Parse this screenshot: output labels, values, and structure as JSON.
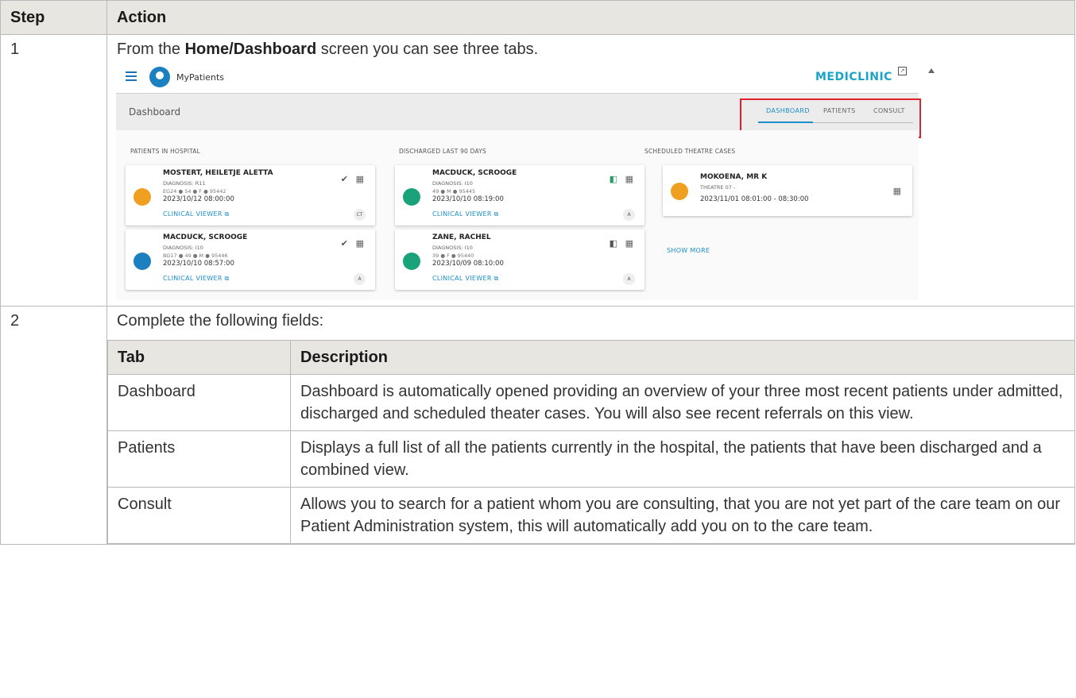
{
  "header": {
    "step_label": "Step",
    "action_label": "Action"
  },
  "row1": {
    "step": "1",
    "text_before": "From the ",
    "text_bold": "Home/Dashboard",
    "text_after": " screen you can see three tabs.",
    "screenshot": {
      "app_name": "MyPatients",
      "brand": "MEDICLINIC",
      "page_title": "Dashboard",
      "tabs": [
        "DASHBOARD",
        "PATIENTS",
        "CONSULT"
      ],
      "active_tab": "DASHBOARD",
      "sections": {
        "in_hospital": "PATIENTS IN HOSPITAL",
        "discharged": "DISCHARGED LAST 90 DAYS",
        "theatre": "SCHEDULED THEATRE CASES"
      },
      "cards": [
        {
          "name": "MOSTERT, HEILETJE ALETTA",
          "diagnosis": "DIAGNOSIS: R11",
          "info": "EG24 ● 54 ● F ● 95442",
          "datetime": "2023/10/12 08:00:00",
          "link": "CLINICAL VIEWER",
          "badge": "CT"
        },
        {
          "name": "MACDUCK, SCROOGE",
          "diagnosis": "DIAGNOSIS: I10",
          "info": "BG17 ● 49 ● M ● 95446",
          "datetime": "2023/10/10 08:57:00",
          "link": "CLINICAL VIEWER",
          "badge": "A"
        },
        {
          "name": "MACDUCK, SCROOGE",
          "diagnosis": "DIAGNOSIS: I10",
          "info": "49 ● M ● 95445",
          "datetime": "2023/10/10 08:19:00",
          "link": "CLINICAL VIEWER",
          "badge": "A"
        },
        {
          "name": "ZANE, RACHEL",
          "diagnosis": "DIAGNOSIS: I10",
          "info": "39 ● F ● 95440",
          "datetime": "2023/10/09 08:10:00",
          "link": "CLINICAL VIEWER",
          "badge": "A"
        },
        {
          "name": "MOKOENA, MR K",
          "location": "THEATRE 07 -",
          "datetime": "2023/11/01 08:01:00 - 08:30:00"
        }
      ],
      "show_more": "SHOW MORE"
    }
  },
  "row2": {
    "step": "2",
    "intro": "Complete the following fields:",
    "table_headers": {
      "tab": "Tab",
      "description": "Description"
    },
    "rows": [
      {
        "tab": "Dashboard",
        "description": "Dashboard is automatically opened providing an overview of your three most recent patients under admitted, discharged and scheduled theater cases. You will also see recent referrals on this view."
      },
      {
        "tab": "Patients",
        "description": "Displays a full list of all the patients currently in the hospital, the patients that have been discharged and a combined view."
      },
      {
        "tab": "Consult",
        "description": "Allows you to search for a patient whom you are consulting, that you are not yet part of the care team on our Patient Administration system, this will automatically add you on to the care team."
      }
    ]
  },
  "colors": {
    "header_bg": "#e8e6e1",
    "accent": "#1c8fc8",
    "highlight": "#e0202a",
    "brand": "#1aa3c8"
  }
}
